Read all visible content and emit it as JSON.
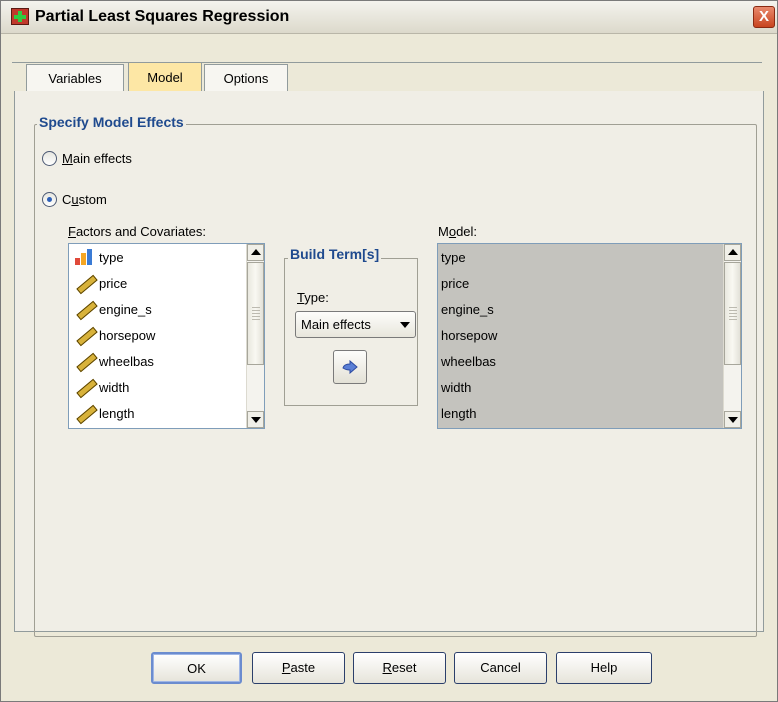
{
  "window": {
    "title": "Partial Least Squares Regression",
    "close_label": "X"
  },
  "tabs": [
    {
      "label": "Variables",
      "active": false
    },
    {
      "label": "Model",
      "active": true
    },
    {
      "label": "Options",
      "active": false
    }
  ],
  "effects": {
    "group_title": "Specify Model Effects",
    "main_effects": {
      "mnemonic": "M",
      "rest": "ain effects",
      "checked": false
    },
    "custom": {
      "prefix": "C",
      "mnemonic": "u",
      "rest": "stom",
      "checked": true
    }
  },
  "factors": {
    "label_mnemonic": "F",
    "label_rest": "actors and Covariates:",
    "items": [
      {
        "name": "type",
        "icon": "nominal-bar-chart-icon"
      },
      {
        "name": "price",
        "icon": "scale-ruler-icon"
      },
      {
        "name": "engine_s",
        "icon": "scale-ruler-icon"
      },
      {
        "name": "horsepow",
        "icon": "scale-ruler-icon"
      },
      {
        "name": "wheelbas",
        "icon": "scale-ruler-icon"
      },
      {
        "name": "width",
        "icon": "scale-ruler-icon"
      },
      {
        "name": "length",
        "icon": "scale-ruler-icon"
      }
    ]
  },
  "build_terms": {
    "title": "Build Term[s]",
    "type_label_mnemonic": "T",
    "type_label_rest": "ype:",
    "type_value": "Main effects",
    "move_icon": "right-arrow-icon"
  },
  "model": {
    "label_prefix": "M",
    "label_mnemonic": "o",
    "label_rest": "del:",
    "items": [
      "type",
      "price",
      "engine_s",
      "horsepow",
      "wheelbas",
      "width",
      "length"
    ]
  },
  "buttons": {
    "ok": "OK",
    "paste_mnemonic": "P",
    "paste_rest": "aste",
    "reset_mnemonic": "R",
    "reset_rest": "eset",
    "cancel": "Cancel",
    "help": "Help"
  },
  "colors": {
    "group_title": "#1f4a8e",
    "active_tab": "#fde7a5",
    "dialog_bg": "#ECE9D8"
  }
}
